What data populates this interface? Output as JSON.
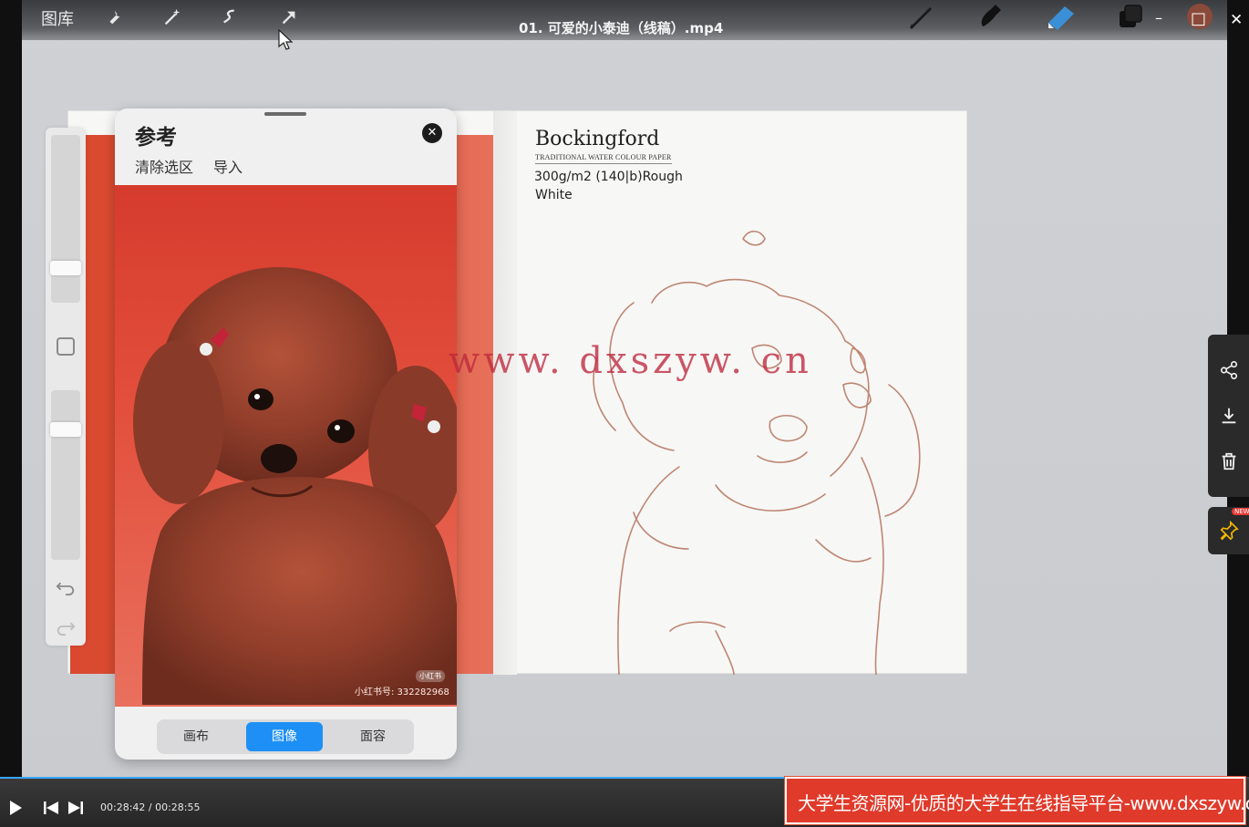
{
  "window": {
    "video_title": "01. 可爱的小泰迪（线稿）.mp4",
    "controls": {
      "minimize": "–",
      "maximize": "□",
      "close": "✕"
    }
  },
  "toolbar": {
    "gallery": "图库",
    "icons": [
      "wrench-icon",
      "magic-wand-icon",
      "selection-icon",
      "transform-arrow-icon",
      "brush-icon",
      "smudge-icon",
      "eraser-icon",
      "layers-icon",
      "color-swatch"
    ],
    "colors": {
      "active_color": "#8a4a3a",
      "eraser_blue": "#3a8fd6"
    }
  },
  "canvas": {
    "brand": "Bockingford",
    "brand_sub": "TRADITIONAL WATER COLOUR PAPER",
    "spec_line1": "300g/m2 (140|b)Rough",
    "spec_line2": "White"
  },
  "reference_panel": {
    "title": "参考",
    "clear_selection": "清除选区",
    "import": "导入",
    "close_icon": "✕",
    "badge": "小红书",
    "id_text": "小红书号: 332282968",
    "tabs": [
      {
        "label": "画布",
        "active": false
      },
      {
        "label": "图像",
        "active": true
      },
      {
        "label": "面容",
        "active": false
      }
    ]
  },
  "watermark": "www. dxszyw. cn",
  "share_bar": {
    "icons": [
      "share-icon",
      "download-icon",
      "delete-icon"
    ],
    "pin_icon": "pin-icon",
    "new_badge": "NEW"
  },
  "player": {
    "time": "00:28:42 / 00:28:55",
    "progress": 0.992,
    "banner": "大学生资源网-优质的大学生在线指导平台-www.dxszyw.cn"
  }
}
